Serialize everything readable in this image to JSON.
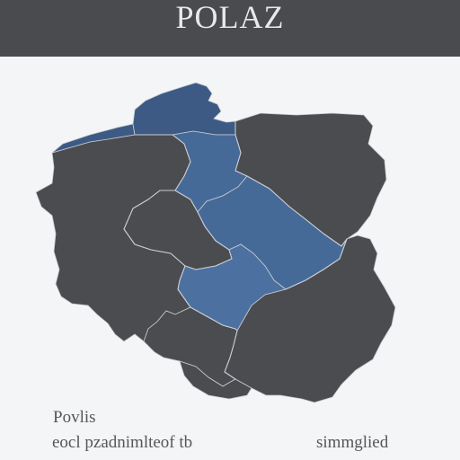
{
  "header": {
    "title": "POLAZ"
  },
  "map": {
    "colors": {
      "background": "#f4f5f6",
      "land": "#4b4c50",
      "highlight_dark": "#3d5a84",
      "highlight_mid": "#466a98",
      "highlight_light": "#4c71a0",
      "border": "#c9ccd2",
      "header": "#4a4b4f"
    },
    "regions": [
      {
        "name": "pomorskie-coast",
        "highlighted": true
      },
      {
        "name": "zachodniopomorskie",
        "highlighted": false
      },
      {
        "name": "kujawsko-pomorskie",
        "highlighted": true
      },
      {
        "name": "warminsko-mazurskie",
        "highlighted": false
      },
      {
        "name": "lubuskie",
        "highlighted": false
      },
      {
        "name": "wielkopolskie",
        "highlighted": false
      },
      {
        "name": "lodzkie",
        "highlighted": true
      },
      {
        "name": "mazowieckie",
        "highlighted": false
      },
      {
        "name": "dolnoslaskie",
        "highlighted": false
      },
      {
        "name": "opolskie",
        "highlighted": true
      },
      {
        "name": "slaskie",
        "highlighted": false
      },
      {
        "name": "malopolskie",
        "highlighted": false
      },
      {
        "name": "podkarpackie",
        "highlighted": false
      },
      {
        "name": "lubelskie",
        "highlighted": false
      }
    ]
  },
  "captions": {
    "label": "Povlis",
    "left": "eocl pzadnimlteof tb",
    "right": "simmglied"
  }
}
